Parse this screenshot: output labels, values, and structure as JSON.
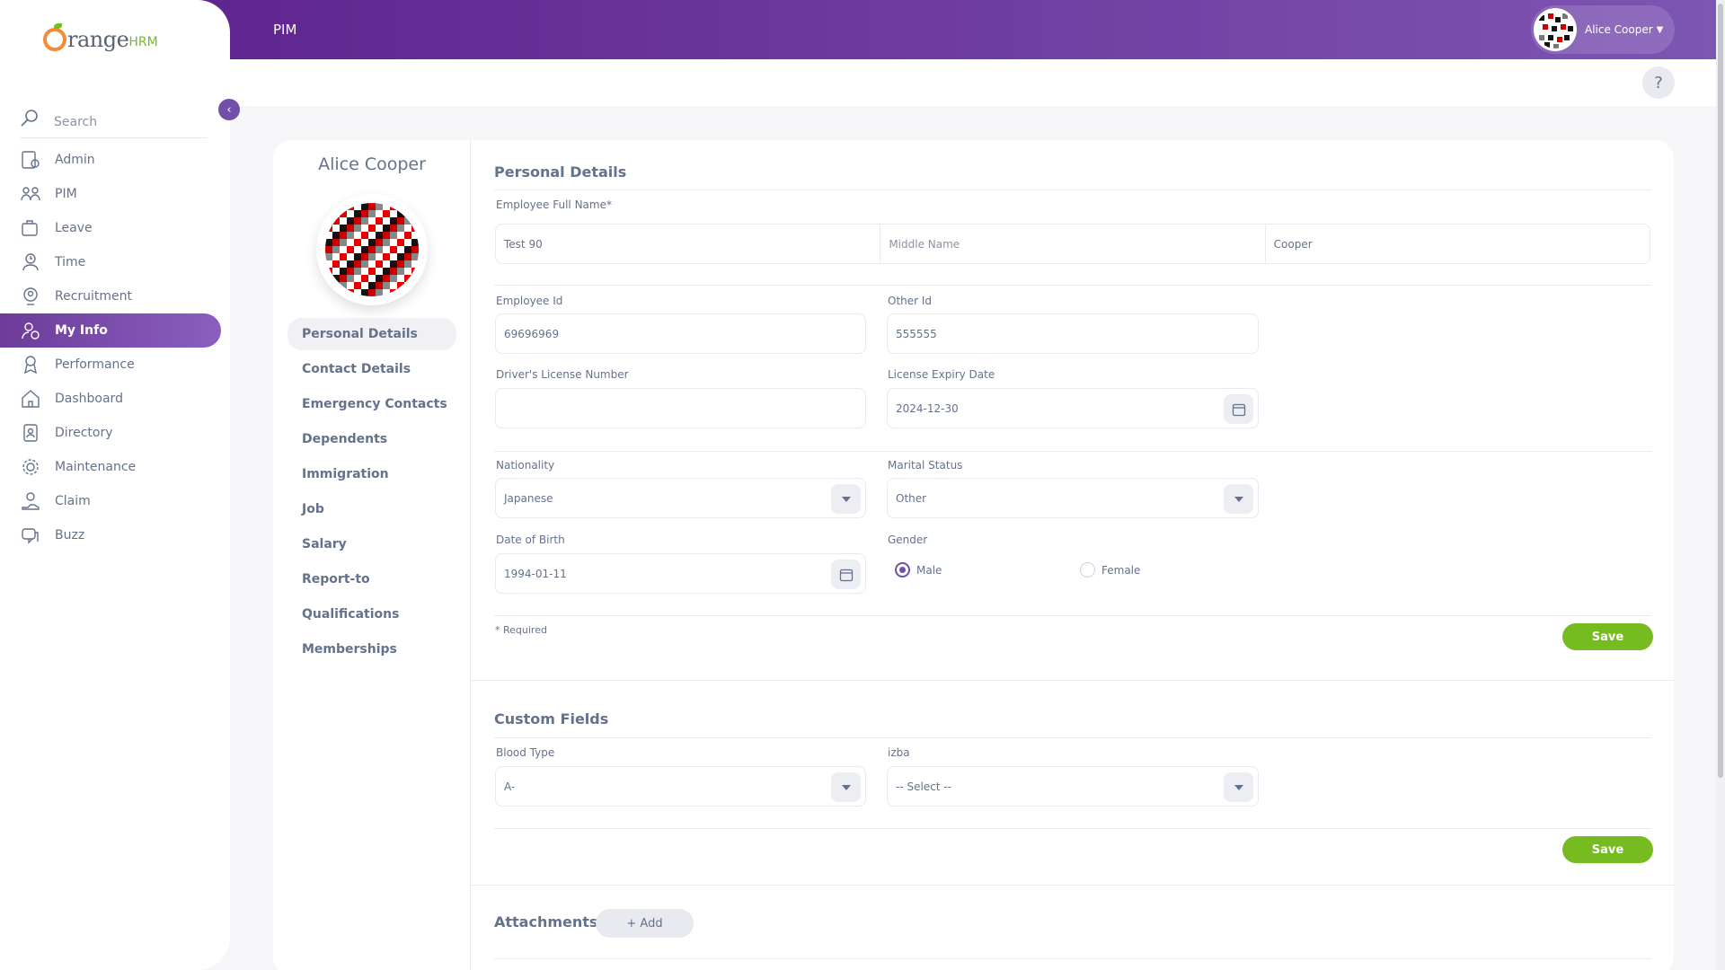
{
  "brand": {
    "logo_main": "range",
    "logo_suffix": "HRM"
  },
  "topbar": {
    "module": "PIM",
    "user_name": "Alice Cooper"
  },
  "sidebar": {
    "search_label": "Search",
    "items": [
      {
        "label": "Admin",
        "icon": "admin-icon"
      },
      {
        "label": "PIM",
        "icon": "pim-icon"
      },
      {
        "label": "Leave",
        "icon": "leave-icon"
      },
      {
        "label": "Time",
        "icon": "time-icon"
      },
      {
        "label": "Recruitment",
        "icon": "recruitment-icon"
      },
      {
        "label": "My Info",
        "icon": "my-info-icon",
        "active": true
      },
      {
        "label": "Performance",
        "icon": "performance-icon"
      },
      {
        "label": "Dashboard",
        "icon": "dashboard-icon"
      },
      {
        "label": "Directory",
        "icon": "directory-icon"
      },
      {
        "label": "Maintenance",
        "icon": "maintenance-icon"
      },
      {
        "label": "Claim",
        "icon": "claim-icon"
      },
      {
        "label": "Buzz",
        "icon": "buzz-icon"
      }
    ]
  },
  "help_label": "?",
  "employee": {
    "name": "Alice Cooper"
  },
  "tabs": [
    "Personal Details",
    "Contact Details",
    "Emergency Contacts",
    "Dependents",
    "Immigration",
    "Job",
    "Salary",
    "Report-to",
    "Qualifications",
    "Memberships"
  ],
  "personal": {
    "title": "Personal Details",
    "full_name_label": "Employee Full Name*",
    "first_name": "Test 90",
    "middle_name_placeholder": "Middle Name",
    "last_name": "Cooper",
    "employee_id_label": "Employee Id",
    "employee_id": "69696969",
    "other_id_label": "Other Id",
    "other_id": "555555",
    "license_label": "Driver's License Number",
    "license_value": "",
    "license_expiry_label": "License Expiry Date",
    "license_expiry": "2024-12-30",
    "nationality_label": "Nationality",
    "nationality": "Japanese",
    "marital_label": "Marital Status",
    "marital": "Other",
    "dob_label": "Date of Birth",
    "dob": "1994-01-11",
    "gender_label": "Gender",
    "gender_male": "Male",
    "gender_female": "Female",
    "gender_selected": "Male",
    "required_note": "* Required",
    "save_label": "Save"
  },
  "custom": {
    "title": "Custom Fields",
    "blood_label": "Blood Type",
    "blood_value": "A-",
    "izba_label": "izba",
    "izba_value": "-- Select --",
    "save_label": "Save"
  },
  "attachments": {
    "title": "Attachments",
    "add_label": "+ Add"
  },
  "colors": {
    "brand_purple": "#6d3c99",
    "save_green": "#76bc21",
    "logo_orange": "#f28c38"
  }
}
